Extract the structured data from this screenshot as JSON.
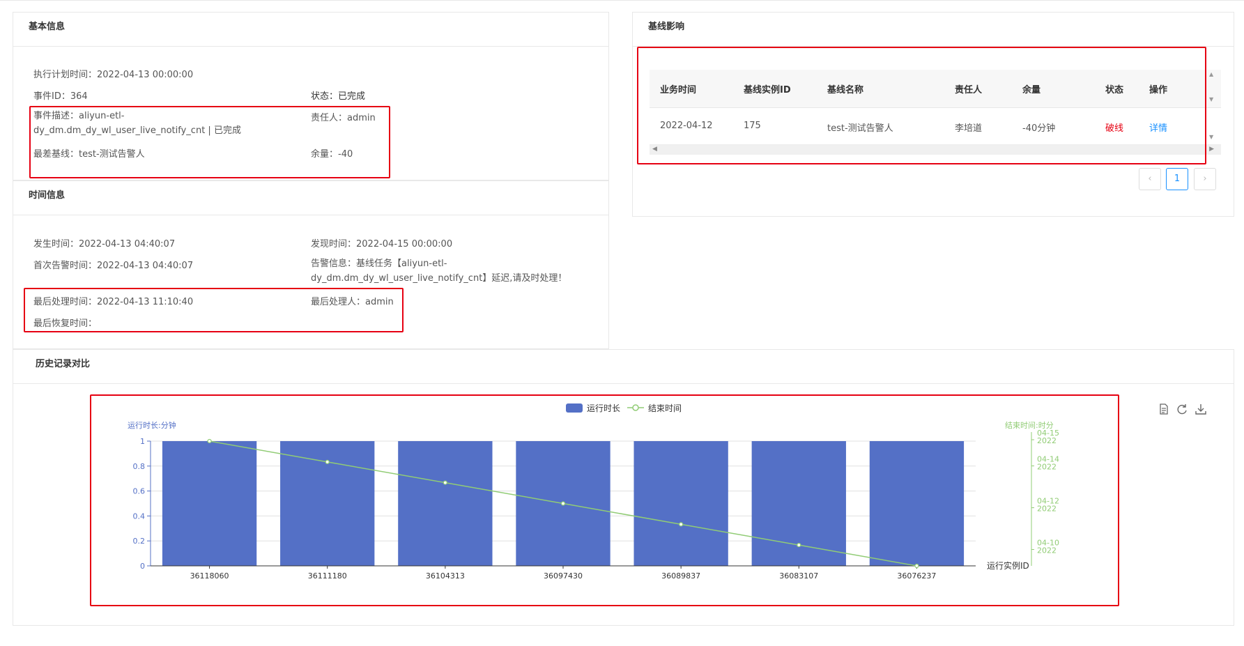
{
  "basic_info": {
    "title": "基本信息",
    "plan_time_label": "执行计划时间：",
    "plan_time": "2022-04-13 00:00:00",
    "event_id_label": "事件ID：",
    "event_id": "364",
    "status_label": "状态：",
    "status": "已完成",
    "event_desc_label": "事件描述：",
    "event_desc": "aliyun-etl-dy_dm.dm_dy_wl_user_live_notify_cnt | 已完成",
    "owner_label": "责任人：",
    "owner": "admin",
    "worst_baseline_label": "最差基线：",
    "worst_baseline": "test-测试告警人",
    "margin_label": "余量：",
    "margin": "-40"
  },
  "time_info": {
    "title": "时间信息",
    "occur_label": "发生时间：",
    "occur": "2022-04-13 04:40:07",
    "discover_label": "发现时间：",
    "discover": "2022-04-15 00:00:00",
    "first_alarm_label": "首次告警时间：",
    "first_alarm": "2022-04-13 04:40:07",
    "alarm_msg_label": "告警信息：",
    "alarm_msg": "基线任务【aliyun-etl-dy_dm.dm_dy_wl_user_live_notify_cnt】延迟,请及时处理！",
    "last_handle_label": "最后处理时间：",
    "last_handle": "2022-04-13 11:10:40",
    "last_handler_label": "最后处理人：",
    "last_handler": "admin",
    "last_recover_label": "最后恢复时间：",
    "last_recover": ""
  },
  "baseline_impact": {
    "title": "基线影响",
    "columns": [
      "业务时间",
      "基线实例ID",
      "基线名称",
      "责任人",
      "余量",
      "状态",
      "操作"
    ],
    "rows": [
      {
        "biz_time": "2022-04-12",
        "instance_id": "175",
        "name": "test-测试告警人",
        "owner": "李培道",
        "margin": "-40分钟",
        "status": "破线",
        "action": "详情"
      }
    ],
    "pagination": {
      "current": "1",
      "prev": "‹",
      "next": "›"
    },
    "status_color": "#e60012",
    "link_color": "#1890ff"
  },
  "history": {
    "title": "历史记录对比"
  },
  "chart_data": {
    "type": "bar",
    "categories": [
      "36118060",
      "36111180",
      "36104313",
      "36097430",
      "36089837",
      "36083107",
      "36076237"
    ],
    "series": [
      {
        "name": "运行时长",
        "type": "bar",
        "values": [
          1,
          1,
          1,
          1,
          1,
          1,
          1
        ],
        "color": "#5470c6"
      },
      {
        "name": "结束时间",
        "type": "line",
        "values": [
          1.0,
          0.833,
          0.667,
          0.5,
          0.333,
          0.167,
          0.0
        ],
        "color": "#91cc75"
      }
    ],
    "ylabel": "运行时长:分钟",
    "ylabel_right": "结束时间:时分",
    "xlabel": "运行实例ID",
    "ylim": [
      0,
      1
    ],
    "yticks": [
      "0",
      "0.2",
      "0.4",
      "0.6",
      "0.8",
      "1"
    ],
    "right_ticks": [
      {
        "line1": "04-15",
        "line2": "2022",
        "value": 1.0
      },
      {
        "line1": "04-14",
        "line2": "2022",
        "value": 0.79
      },
      {
        "line1": "04-12",
        "line2": "2022",
        "value": 0.455
      },
      {
        "line1": "04-10",
        "line2": "2022",
        "value": 0.12
      }
    ],
    "legend": [
      "运行时长",
      "结束时间"
    ],
    "legend_position": "top-center",
    "grid": true
  },
  "toolbox": [
    "data-view-icon",
    "refresh-icon",
    "download-icon"
  ]
}
